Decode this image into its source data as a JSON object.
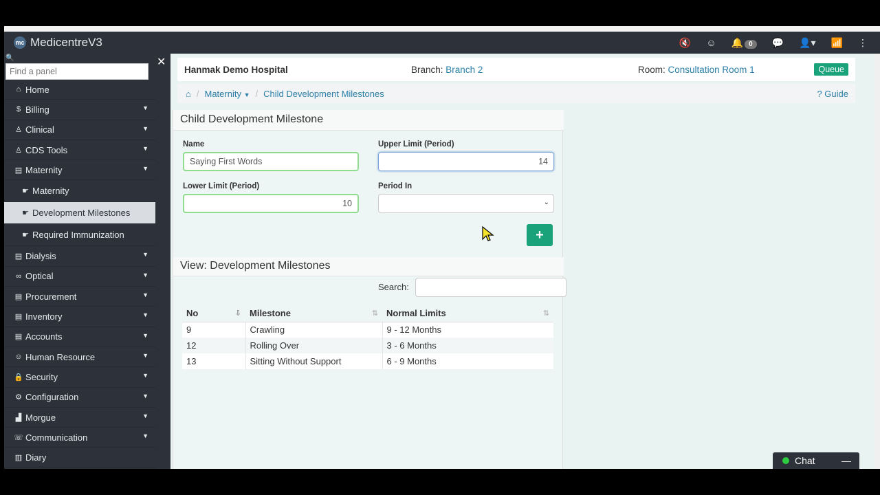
{
  "app": {
    "brand": "MedicentreV3",
    "brand_logo": "mc"
  },
  "topbar": {
    "notification_count": "0"
  },
  "sidebar": {
    "find_placeholder": "Find a panel",
    "items": [
      {
        "label": "Home",
        "icon": "⌂"
      },
      {
        "label": "Billing",
        "icon": "$"
      },
      {
        "label": "Clinical",
        "icon": "♙"
      },
      {
        "label": "CDS Tools",
        "icon": "♙"
      },
      {
        "label": "Maternity",
        "icon": "▤"
      },
      {
        "label": "Maternity",
        "icon": "☛"
      },
      {
        "label": "Development Milestones",
        "icon": "☛"
      },
      {
        "label": "Required Immunization",
        "icon": "☛"
      },
      {
        "label": "Dialysis",
        "icon": "▤"
      },
      {
        "label": "Optical",
        "icon": "∞"
      },
      {
        "label": "Procurement",
        "icon": "▤"
      },
      {
        "label": "Inventory",
        "icon": "▤"
      },
      {
        "label": "Accounts",
        "icon": "▤"
      },
      {
        "label": "Human Resource",
        "icon": "☺"
      },
      {
        "label": "Security",
        "icon": "🔒"
      },
      {
        "label": "Configuration",
        "icon": "⚙"
      },
      {
        "label": "Morgue",
        "icon": "▟"
      },
      {
        "label": "Communication",
        "icon": "☏"
      },
      {
        "label": "Diary",
        "icon": "▥"
      }
    ]
  },
  "header": {
    "hospital": "Hanmak Demo Hospital",
    "branch_label": "Branch:",
    "branch_value": "Branch 2",
    "room_label": "Room:",
    "room_value": "Consultation Room 1",
    "queue": "Queue"
  },
  "breadcrumb": {
    "maternity": "Maternity",
    "current": "Child Development Milestones",
    "guide": "Guide"
  },
  "form": {
    "title": "Child Development Milestone",
    "name_label": "Name",
    "name_value": "Saying First Words",
    "upper_label": "Upper Limit (Period)",
    "upper_value": "14",
    "lower_label": "Lower Limit (Period)",
    "lower_value": "10",
    "period_label": "Period In",
    "period_value": "",
    "add_button": "+"
  },
  "view": {
    "title": "View: Development Milestones",
    "search_label": "Search:",
    "columns": [
      "No",
      "Milestone",
      "Normal Limits"
    ],
    "rows": [
      {
        "no": "9",
        "milestone": "Crawling",
        "limits": "9 - 12 Months"
      },
      {
        "no": "12",
        "milestone": "Rolling Over",
        "limits": "3 - 6 Months"
      },
      {
        "no": "13",
        "milestone": "Sitting Without Support",
        "limits": "6 - 9 Months"
      }
    ]
  },
  "chat": {
    "label": "Chat",
    "minimize": "—"
  },
  "colors": {
    "sidebar_bg": "#2d3139",
    "accent_green": "#1aa27a",
    "link_blue": "#2a7fa8",
    "content_bg": "#e9f4f2"
  }
}
